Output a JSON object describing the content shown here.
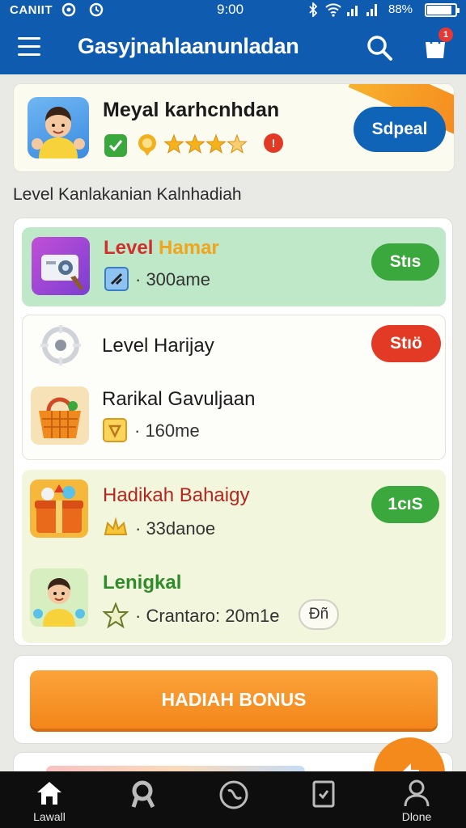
{
  "status_bar": {
    "carrier": "CANIIT",
    "time": "9:00",
    "battery": "88%",
    "battery_level": 0.88
  },
  "app_bar": {
    "title": "Gasyjnahlaanunladan",
    "cart_count": "1"
  },
  "profile": {
    "name": "Meyal karhcnhdan",
    "rating_stars": 3.5,
    "button_label": "Sdpeal"
  },
  "section_title": "Level Kanlakanian Kalnhadiah",
  "rewards": [
    {
      "title": "Level Hamar",
      "subtitle": "· 300ame",
      "button": "Stıs",
      "button_color": "#3aa83c",
      "title_color": "#d0302a"
    },
    {
      "title": "Level Harijay",
      "button": "Stıö",
      "button_color": "#e23a25",
      "title_color": "#1b1b1b"
    },
    {
      "title": "Rarikal Gavuljaan",
      "subtitle": "· 160me",
      "title_color": "#1b1b1b"
    },
    {
      "title": "Hadikah Bahaigy",
      "subtitle": "· 33danoe",
      "button": "1cıS",
      "button_color": "#3aa83c",
      "title_color": "#b52620"
    },
    {
      "title": "Lenigkal",
      "subtitle": "· Crantaro: 20m1e",
      "tag": "Đñ",
      "title_color": "#2f8c2a"
    }
  ],
  "bonus_button": "HADIAH BONUS",
  "bottom_nav": [
    {
      "label": "Lawall",
      "icon": "home-icon"
    },
    {
      "label": "",
      "icon": "rank-icon"
    },
    {
      "label": "",
      "icon": "globe-icon"
    },
    {
      "label": "",
      "icon": "task-icon"
    },
    {
      "label": "Dlone",
      "icon": "profile-icon"
    }
  ]
}
